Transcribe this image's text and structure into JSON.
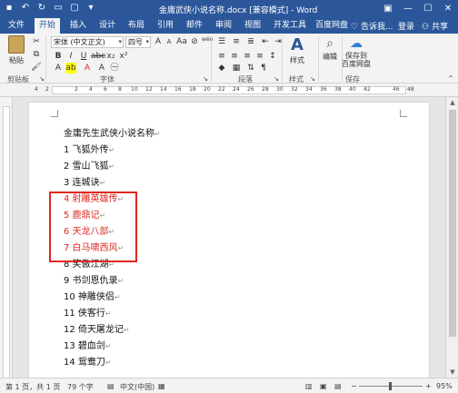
{
  "window": {
    "title": "金庸武侠小说名称.docx [兼容模式] - Word"
  },
  "tabs": [
    {
      "label": "文件"
    },
    {
      "label": "开始"
    },
    {
      "label": "插入"
    },
    {
      "label": "设计"
    },
    {
      "label": "布局"
    },
    {
      "label": "引用"
    },
    {
      "label": "邮件"
    },
    {
      "label": "审阅"
    },
    {
      "label": "视图"
    },
    {
      "label": "开发工具"
    },
    {
      "label": "百度网盘"
    }
  ],
  "tab_right": {
    "tell_me": "告诉我...",
    "login": "登录",
    "share": "共享"
  },
  "ribbon": {
    "paste_label": "粘贴",
    "font_name": "宋体 (中文正文)",
    "font_size": "四号",
    "wen_glyph": "wén",
    "styles_label": "样式",
    "edit_label": "编辑",
    "save_baidu_label": "保存到\n百度网盘",
    "groups": {
      "clipboard": "剪贴板",
      "font": "字体",
      "paragraph": "段落",
      "styles": "样式",
      "save": "保存"
    }
  },
  "ruler_numbers": [
    "4",
    "2",
    "2",
    "4",
    "6",
    "8",
    "10",
    "12",
    "14",
    "16",
    "18",
    "20",
    "22",
    "24",
    "26",
    "28",
    "30",
    "32",
    "34",
    "36",
    "38",
    "40",
    "42",
    "46",
    "48"
  ],
  "document": {
    "lines": [
      {
        "text": "金庸先生武侠小说名称",
        "highlight": false
      },
      {
        "text": "1 飞狐外传",
        "highlight": false
      },
      {
        "text": "2 雪山飞狐",
        "highlight": false
      },
      {
        "text": "3 连城诀",
        "highlight": false
      },
      {
        "text": "4 射雕英雄传",
        "highlight": true
      },
      {
        "text": "5 鹿鼎记",
        "highlight": true
      },
      {
        "text": "6 天龙八部",
        "highlight": true
      },
      {
        "text": "7 白马啸西风",
        "highlight": true
      },
      {
        "text": "8 笑傲江湖",
        "highlight": false
      },
      {
        "text": "9 书剑恩仇录",
        "highlight": false
      },
      {
        "text": "10 神雕侠侣",
        "highlight": false
      },
      {
        "text": "11 侠客行",
        "highlight": false
      },
      {
        "text": "12 倚天屠龙记",
        "highlight": false
      },
      {
        "text": "13 碧血剑",
        "highlight": false
      },
      {
        "text": "14 鸳鸯刀",
        "highlight": false
      }
    ]
  },
  "statusbar": {
    "page": "第 1 页，共 1 页",
    "words": "79 个字",
    "lang": "中文(中国)",
    "zoom": "95%"
  },
  "colors": {
    "accent": "#2b579a",
    "highlight_text": "#e0281e"
  }
}
